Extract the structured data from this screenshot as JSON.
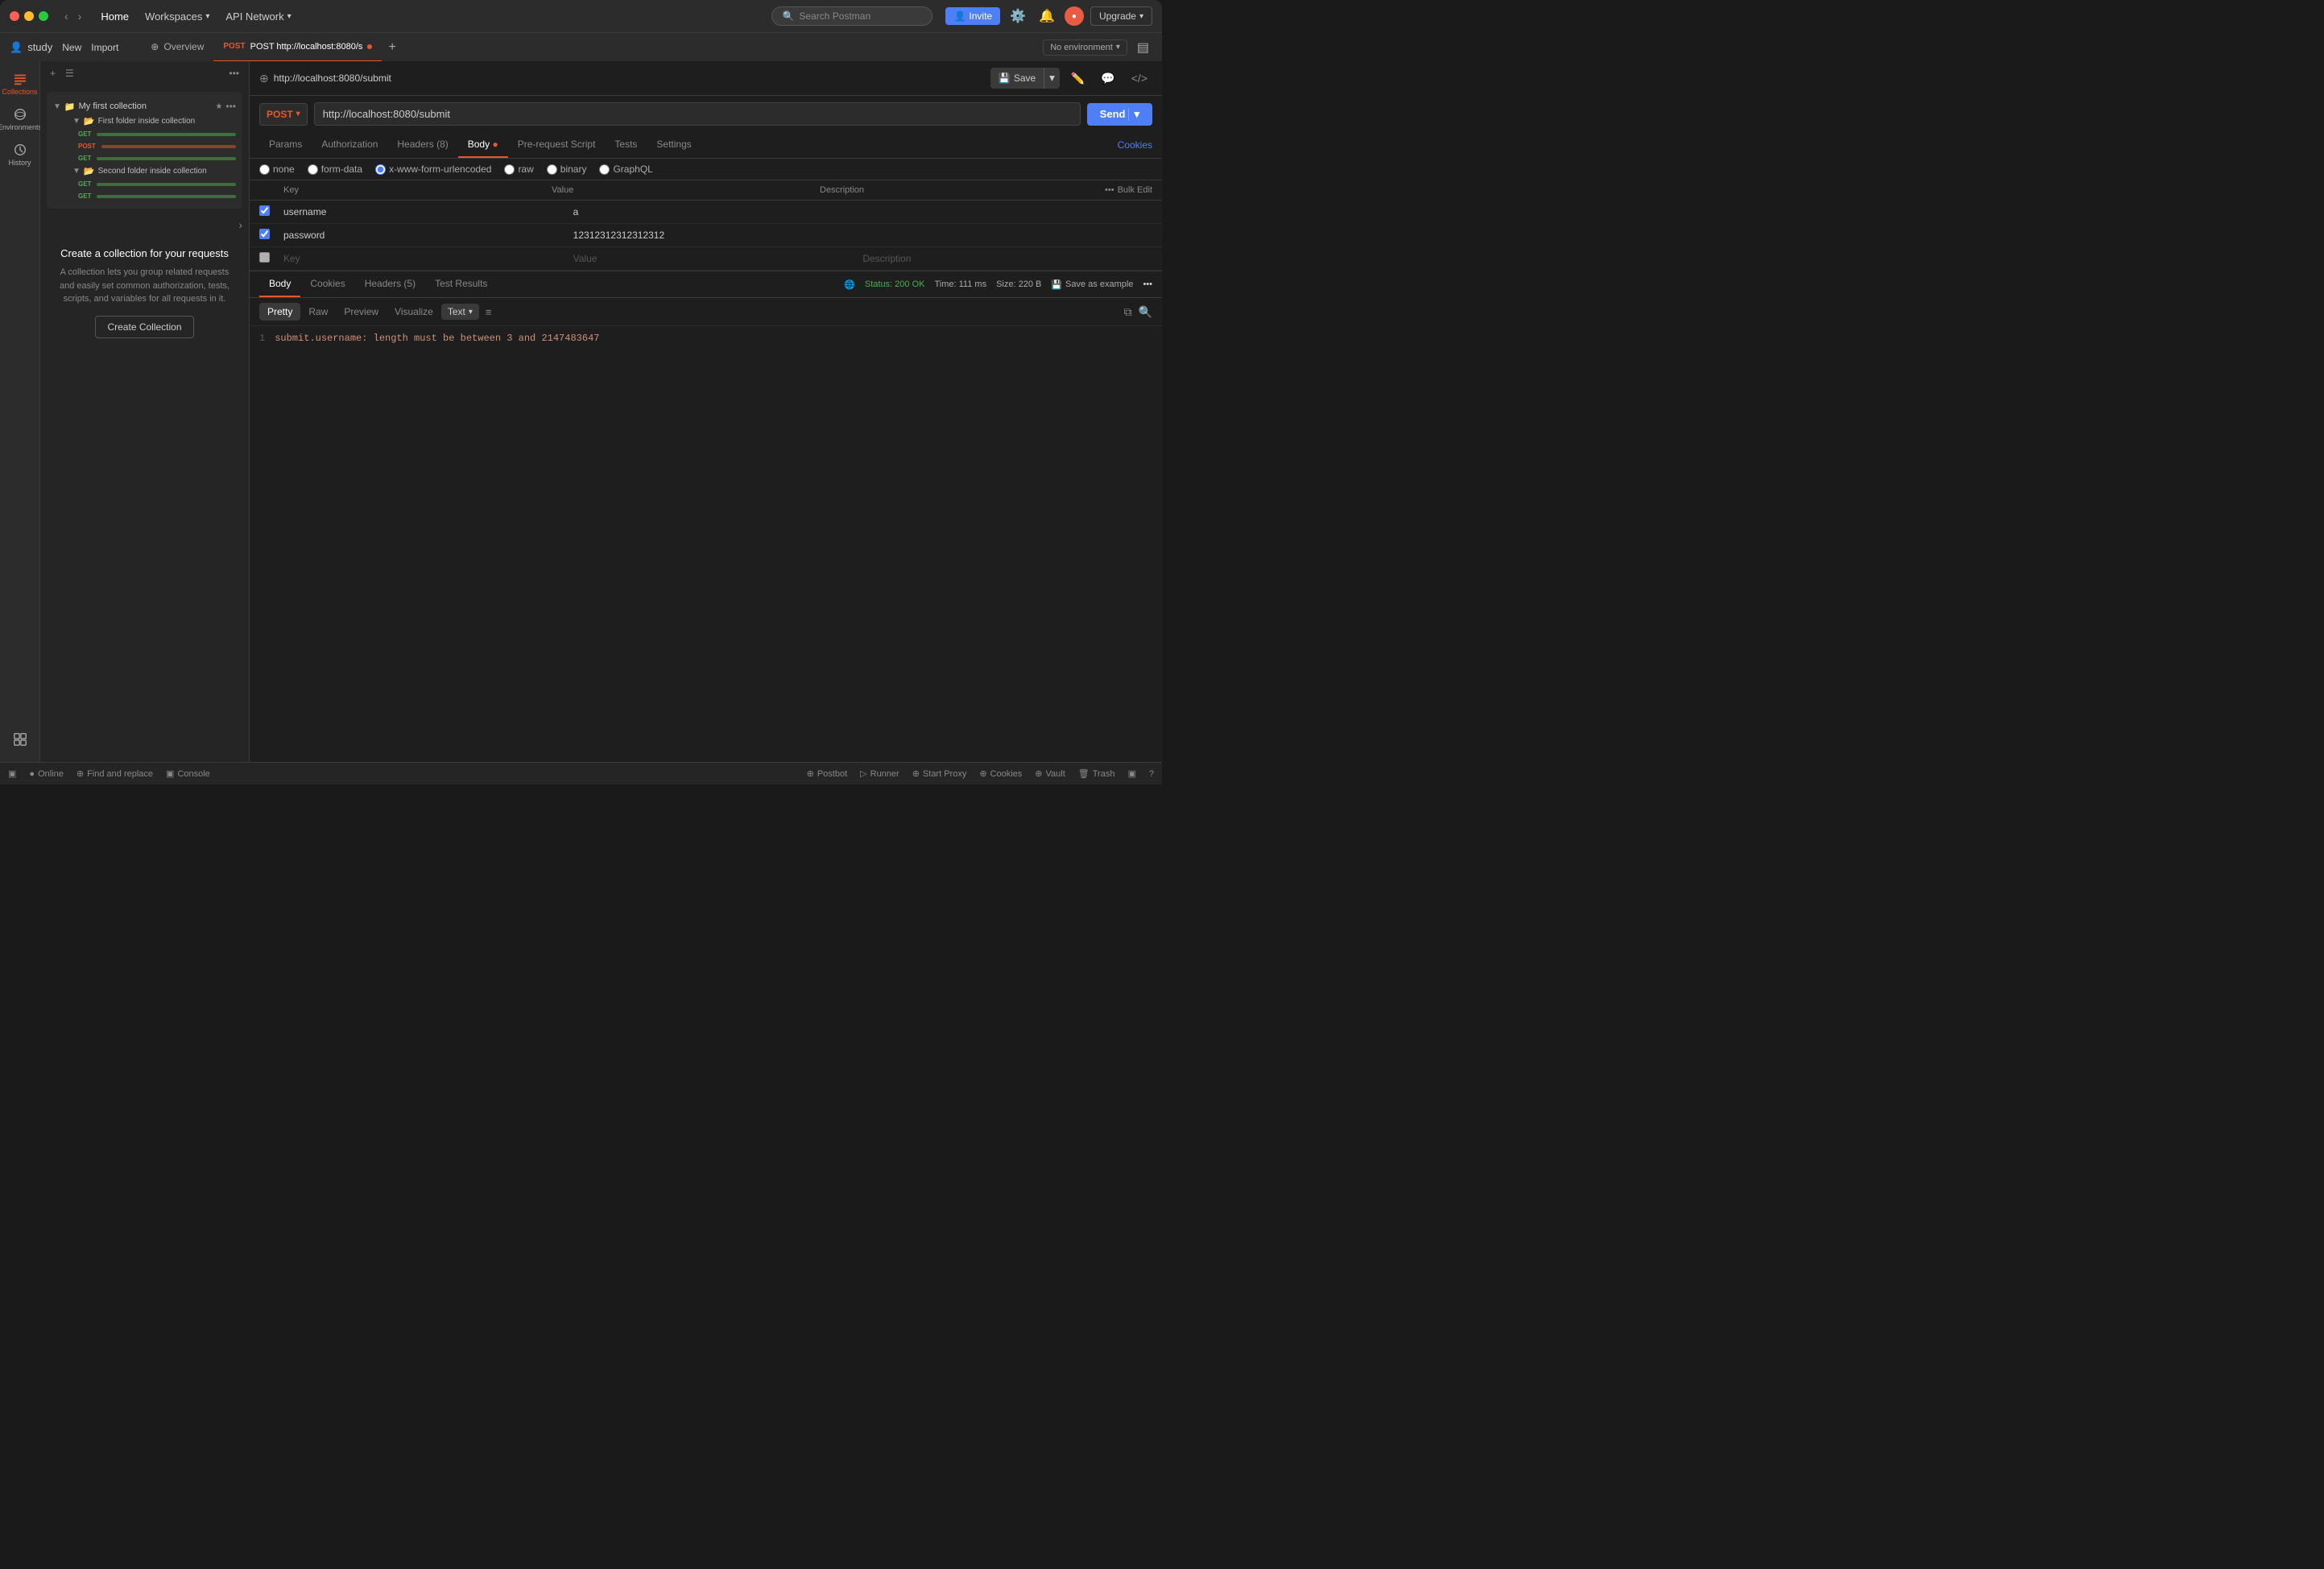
{
  "titlebar": {
    "home": "Home",
    "workspaces": "Workspaces",
    "api_network": "API Network",
    "search_placeholder": "Search Postman",
    "invite_label": "Invite",
    "upgrade_label": "Upgrade"
  },
  "subheader": {
    "user": "study",
    "new_label": "New",
    "import_label": "Import",
    "overview_tab": "Overview",
    "request_tab": "POST http://localhost:8080/s",
    "no_environment": "No environment"
  },
  "sidebar": {
    "collections_label": "Collections",
    "environments_label": "Environments",
    "history_label": "History"
  },
  "side_panel": {
    "collection_name": "My first collection",
    "folder1": "First folder inside collection",
    "folder2": "Second folder inside collection",
    "create_title": "Create a collection for your requests",
    "create_desc": "A collection lets you group related requests and easily set common authorization, tests, scripts, and variables for all requests in it.",
    "create_btn": "Create Collection"
  },
  "request": {
    "url_display": "http://localhost:8080/submit",
    "method": "POST",
    "url": "http://localhost:8080/submit",
    "send_label": "Send",
    "save_label": "Save",
    "tabs": {
      "params": "Params",
      "authorization": "Authorization",
      "headers": "Headers (8)",
      "body": "Body",
      "pre_request": "Pre-request Script",
      "tests": "Tests",
      "settings": "Settings"
    },
    "cookies_link": "Cookies",
    "body_options": {
      "none": "none",
      "form_data": "form-data",
      "urlencoded": "x-www-form-urlencoded",
      "raw": "raw",
      "binary": "binary",
      "graphql": "GraphQL"
    },
    "kv_headers": {
      "key": "Key",
      "value": "Value",
      "description": "Description",
      "bulk_edit": "Bulk Edit"
    },
    "kv_rows": [
      {
        "checked": true,
        "key": "username",
        "value": "a",
        "description": ""
      },
      {
        "checked": true,
        "key": "password",
        "value": "12312312312312312",
        "description": ""
      },
      {
        "checked": false,
        "key": "Key",
        "value": "Value",
        "description": "Description"
      }
    ]
  },
  "response": {
    "tabs": {
      "body": "Body",
      "cookies": "Cookies",
      "headers": "Headers (5)",
      "test_results": "Test Results"
    },
    "status": "Status: 200 OK",
    "time": "Time: 111 ms",
    "size": "Size: 220 B",
    "save_example": "Save as example",
    "format_tabs": {
      "pretty": "Pretty",
      "raw": "Raw",
      "preview": "Preview",
      "visualize": "Visualize",
      "text": "Text"
    },
    "body_content": "submit.username: length must be between 3 and 2147483647",
    "line_number": "1"
  },
  "bottombar": {
    "online": "Online",
    "find_replace": "Find and replace",
    "console": "Console",
    "postbot": "Postbot",
    "runner": "Runner",
    "start_proxy": "Start Proxy",
    "cookies": "Cookies",
    "vault": "Vault",
    "trash": "Trash"
  }
}
